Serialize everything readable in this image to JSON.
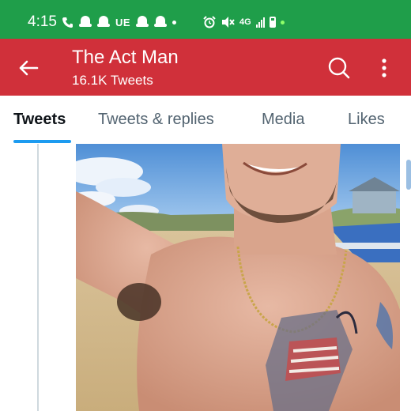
{
  "status_bar": {
    "time": "4:15",
    "carrier_label": "UE",
    "network_label": "4G",
    "icons": [
      "phone-icon",
      "ghost-icon",
      "ghost-icon",
      "ghost-icon",
      "ghost-icon",
      "alarm-icon",
      "mute-icon",
      "signal-icon",
      "battery-icon"
    ]
  },
  "header": {
    "title": "The Act Man",
    "subtitle": "16.1K Tweets",
    "back_icon": "back-arrow-icon",
    "search_icon": "search-icon",
    "more_icon": "more-vertical-icon",
    "color": "#d0303a"
  },
  "tabs": [
    {
      "label": "Tweets",
      "active": true
    },
    {
      "label": "Tweets & replies",
      "active": false
    },
    {
      "label": "Media",
      "active": false
    },
    {
      "label": "Likes",
      "active": false
    }
  ],
  "colors": {
    "status_bar": "#1f9e4a",
    "accent": "#1d9bf0"
  }
}
